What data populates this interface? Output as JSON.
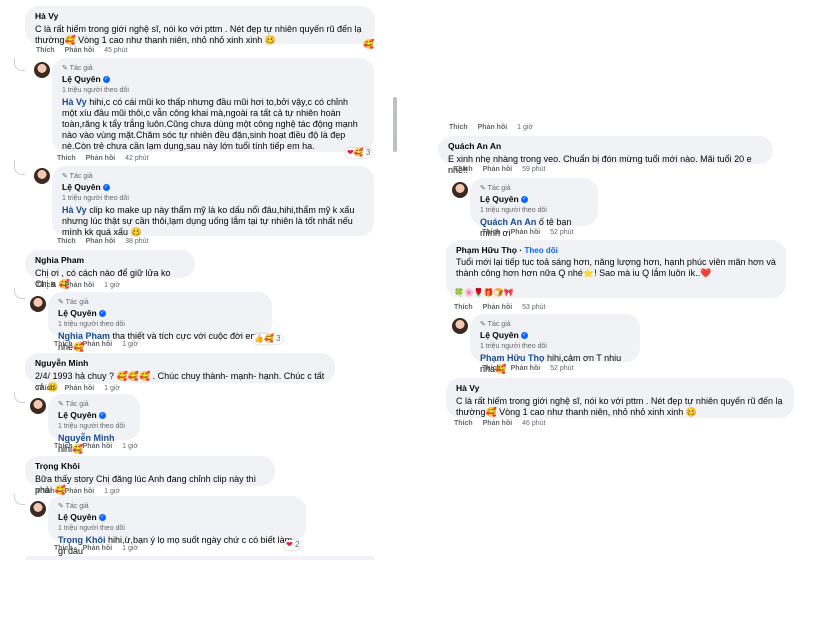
{
  "labels": {
    "like": "Thích",
    "reply": "Phản hồi",
    "author_badge": "✎ Tác giả",
    "followers": "1 triệu người theo dõi",
    "follow": "Theo dõi"
  },
  "left": {
    "c1": {
      "name": "Hà Vy",
      "text": "C là rất hiếm trong giới nghệ sĩ, nói ko với pttm . Nét đẹp tự nhiên quyến rũ đến lạ thường🥰 Vòng 1 cao như thanh niên, nhỏ nhỏ xinh xinh 🥴",
      "time": "45 phút",
      "emoji": "🥰"
    },
    "r1": {
      "name": "Lệ Quyên",
      "tag": "Hà Vy",
      "text": " hihi,c có cái mũi ko thấp nhưng đầu mũi hơi to,bởi vậy,c có chỉnh một xíu đầu mũi thôi,c vẫn công khai mà,ngoài ra tất cả tự nhiên hoàn toàn,răng k tẩy trắng luôn.Cũng chưa dùng một công nghệ tác động mạnh nào vào vùng mặt.Chăm sóc tự nhiên đều đặn,sinh hoạt điều độ là đẹp nè.Còn trẻ chưa cần lạm dụng,sau này lớn tuổi tính tiếp em ha.",
      "time": "42 phút",
      "reacts": "3"
    },
    "r2": {
      "name": "Lệ Quyên",
      "tag": "Hà Vy",
      "text": " clip ko make up này thẩm mỹ là ko dấu nổi đâu,hihi,thẩm mỹ k xấu nhưng lúc thật sự cần thôi,lạm dụng uống lắm tại tự nhiên là tốt nhất nếu mình kk quá xấu 🥴",
      "time": "38 phút"
    },
    "c2": {
      "name": "Nghia Pham",
      "text": "Chị ơi , có cách nào để giữ lửa ko Chị a 🥰",
      "time": "1 giờ"
    },
    "r3": {
      "name": "Lệ Quyên",
      "tag": "Nghia Pham",
      "text": " tha thiết và tích cực với cuộc đời em nhé🥰",
      "time": "1 giờ",
      "reacts": "3"
    },
    "c3": {
      "name": "Nguyễn Minh",
      "text": "2/4/ 1993 hả chuy ? 🥰🥰🥰 . Chúc chuy thành- mạnh- hạnh. Chúc c tất cả 🥴",
      "time": "1 giờ"
    },
    "r4": {
      "name": "Lệ Quyên",
      "tag": "Nguyễn Minh",
      "text": " hihi🥰",
      "time": "1 giờ"
    },
    "c4": {
      "name": "Trọng Khôi",
      "text": "Bữa thấy story Chị đăng lúc Anh đang chỉnh clip này thì phải 🥰",
      "time": "1 giờ"
    },
    "r5": {
      "name": "Lệ Quyên",
      "tag": "Trọng Khôi",
      "text": " hihi,ừ,bạn ý lọ mọ suốt ngày chứ c có biết làm gì đâu",
      "time": "1 giờ",
      "reacts": "2"
    }
  },
  "right": {
    "top": {
      "time": "1 giờ"
    },
    "c1": {
      "name": "Quách An An",
      "text": "E xinh nhẹ nhàng trong veo. Chuẩn bị đón mừng tuổi mới nào. Mãi tuổi 20 e nhé!!",
      "time": "59 phút"
    },
    "r1": {
      "name": "Lệ Quyên",
      "tag": "Quách An An",
      "text": " ố tê bạn mình ơi",
      "time": "52 phút"
    },
    "c2": {
      "name": "Phạm Hữu Thọ",
      "text": "Tuổi mới lại tiếp tục toả sáng hơn, năng lượng hơn, hạnh phúc viên mãn hơn và thành công hơn hơn nữa Q nhé⭐! Sao mà iu Q lắm luôn ík..❤️",
      "icons": "🍀🌸🌹🎁🍞🎀",
      "time": "53 phút"
    },
    "r2": {
      "name": "Lệ Quyên",
      "tag": "Phạm Hữu Thọ",
      "text": " hihi,cảm ơn T nhiu nha🥰",
      "time": "52 phút"
    },
    "c3": {
      "name": "Hà Vy",
      "text": "C là rất hiếm trong giới nghệ sĩ, nói ko với pttm . Nét đẹp tự nhiên quyến rũ đến lạ thường🥰 Vòng 1 cao như thanh niên, nhỏ nhỏ xinh xinh 🥴",
      "time": "46 phút"
    }
  },
  "react_icons": {
    "heart": "❤",
    "care": "🥰",
    "like": "👍"
  }
}
